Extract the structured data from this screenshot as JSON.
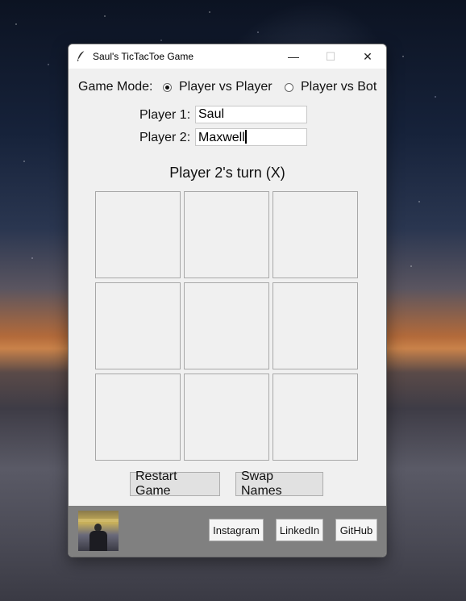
{
  "window": {
    "title": "Saul's TicTacToe Game",
    "minimize_glyph": "—",
    "maximize_glyph": "☐",
    "close_glyph": "✕"
  },
  "game_mode": {
    "label": "Game Mode:",
    "options": [
      "Player vs Player",
      "Player vs Bot"
    ],
    "selected": "Player vs Player"
  },
  "players": {
    "p1_label": "Player 1:",
    "p1_value": "Saul",
    "p2_label": "Player 2:",
    "p2_value": "Maxwell"
  },
  "status": "Player 2's turn (X)",
  "board": [
    "",
    "",
    "",
    "",
    "",
    "",
    "",
    "",
    ""
  ],
  "buttons": {
    "restart": "Restart Game",
    "swap": "Swap Names"
  },
  "footer": {
    "instagram": "Instagram",
    "linkedin": "LinkedIn",
    "github": "GitHub"
  },
  "colors": {
    "window_bg": "#f0f0f0",
    "footer_bg": "#808080",
    "button_bg": "#e1e1e1"
  },
  "icons": {
    "app": "feather-icon",
    "avatar": "profile-photo"
  }
}
